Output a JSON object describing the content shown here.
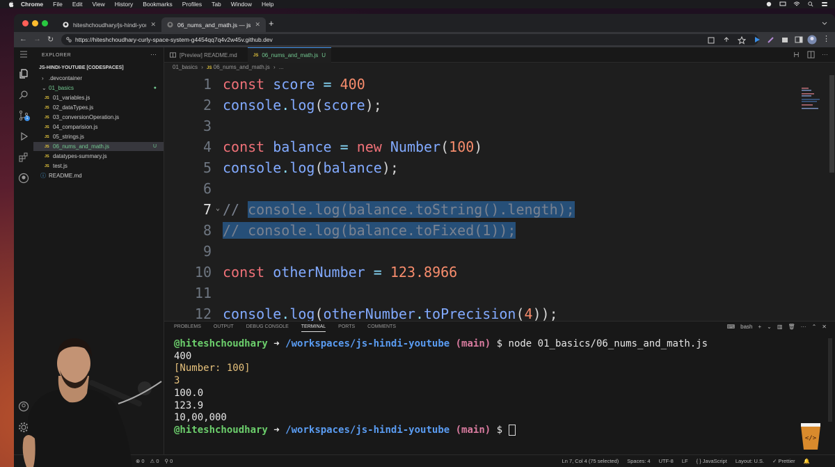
{
  "menubar": {
    "app": "Chrome",
    "items": [
      "File",
      "Edit",
      "View",
      "History",
      "Bookmarks",
      "Profiles",
      "Tab",
      "Window",
      "Help"
    ]
  },
  "browser": {
    "tabs": [
      {
        "title": "hiteshchoudhary/js-hindi-youtu"
      },
      {
        "title": "06_nums_and_math.js — js-hindi-"
      }
    ],
    "url": "https://hiteshchoudhary-curly-space-system-g4454qq7q4v2w45v.github.dev"
  },
  "explorer": {
    "header": "EXPLORER",
    "project": "JS-HINDI-YOUTUBE [CODESPACES]",
    "items": [
      {
        "label": ".devcontainer"
      },
      {
        "label": "01_basics"
      },
      {
        "label": "01_variables.js"
      },
      {
        "label": "02_dataTypes.js"
      },
      {
        "label": "03_conversionOperation.js"
      },
      {
        "label": "04_comparision.js"
      },
      {
        "label": "05_strings.js"
      },
      {
        "label": "06_nums_and_math.js",
        "status": "U"
      },
      {
        "label": "datatypes-summary.js"
      },
      {
        "label": "test.js"
      },
      {
        "label": "README.md"
      }
    ],
    "scm_badge": "1"
  },
  "editor": {
    "tabs": [
      {
        "label": "[Preview] README.md"
      },
      {
        "label": "06_nums_and_math.js",
        "status": "U"
      }
    ],
    "breadcrumb": [
      "01_basics",
      "06_nums_and_math.js",
      "..."
    ],
    "line_numbers": [
      "1",
      "2",
      "3",
      "4",
      "5",
      "6",
      "7",
      "8",
      "9",
      "10",
      "11",
      "12"
    ],
    "lines": [
      "const score = 400",
      "console.log(score);",
      "",
      "const balance = new Number(100)",
      "console.log(balance);",
      "",
      "// console.log(balance.toString().length);",
      "// console.log(balance.toFixed(1));",
      "",
      "const otherNumber = 123.8966",
      "",
      "console.log(otherNumber.toPrecision(4));"
    ]
  },
  "panel": {
    "tabs": [
      "PROBLEMS",
      "OUTPUT",
      "DEBUG CONSOLE",
      "TERMINAL",
      "PORTS",
      "COMMENTS"
    ],
    "active_tab": "TERMINAL",
    "shell": "bash",
    "prompt_user": "@hiteshchoudhary",
    "prompt_arrow": "➜",
    "prompt_path": "/workspaces/js-hindi-youtube",
    "prompt_branch": "(main)",
    "prompt_dollar": "$",
    "command": "node 01_basics/06_nums_and_math.js",
    "output": [
      "400",
      "[Number: 100]",
      "3",
      "100.0",
      "123.9",
      "10,00,000"
    ]
  },
  "statusbar": {
    "left": [
      "⊗ 0",
      "⚠ 0",
      "⚲ 0"
    ],
    "right": [
      "Ln 7, Col 4 (75 selected)",
      "Spaces: 4",
      "UTF-8",
      "LF",
      "{ } JavaScript",
      "Layout: U.S.",
      "✓ Prettier"
    ]
  },
  "colors": {
    "keyword": "#f07178",
    "identifier": "#82aaff",
    "number": "#f78c6c",
    "selection": "#264f78",
    "git_untracked": "#73c991"
  }
}
